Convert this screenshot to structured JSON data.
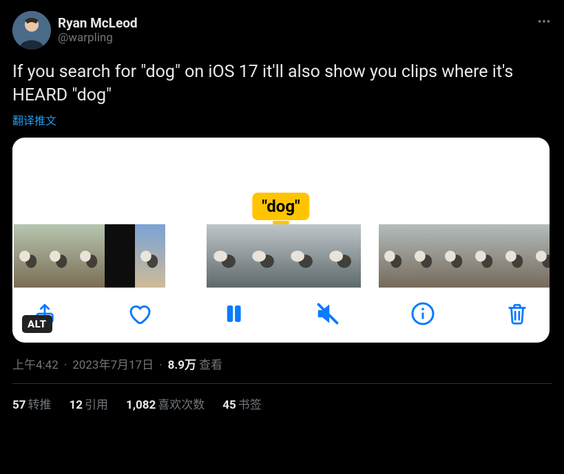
{
  "user": {
    "display_name": "Ryan McLeod",
    "handle": "@warpling"
  },
  "body": "If you search for \"dog\" on iOS 17 it'll also show you clips where it's HEARD \"dog\"",
  "translate": "翻译推文",
  "media": {
    "chip": "\"dog\"",
    "alt_badge": "ALT"
  },
  "meta": {
    "time": "上午4:42",
    "date": "2023年7月17日",
    "views_count": "8.9万",
    "views_label": "查看"
  },
  "stats": {
    "retweets_count": "57",
    "retweets_label": "转推",
    "quotes_count": "12",
    "quotes_label": "引用",
    "likes_count": "1,082",
    "likes_label": "喜欢次数",
    "bookmarks_count": "45",
    "bookmarks_label": "书签"
  }
}
